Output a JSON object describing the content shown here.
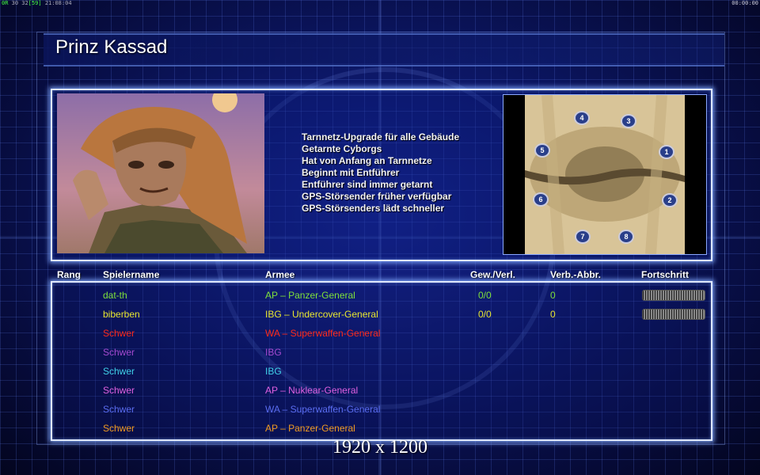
{
  "hud": {
    "left_prefix": "0R",
    "left_text": "30 32",
    "left_bracket": "[59]",
    "left_time": "21:08:04",
    "right_time": "00:00:00"
  },
  "title": "Prinz Kassad",
  "features": [
    "Tarnnetz-Upgrade für alle Gebäude",
    "Getarnte Cyborgs",
    "Hat von Anfang an Tarnnetze",
    "Beginnt mit Entführer",
    "Entführer sind immer getarnt",
    "GPS-Störsender früher verfügbar",
    "GPS-Störsenders lädt schneller"
  ],
  "map_slots": [
    "1",
    "2",
    "3",
    "4",
    "5",
    "6",
    "7",
    "8"
  ],
  "table_headers": {
    "rank": "Rang",
    "player": "Spielername",
    "army": "Armee",
    "winloss": "Gew./Verl.",
    "disconnects": "Verb.-Abbr.",
    "progress": "Fortschritt"
  },
  "players": [
    {
      "name": "dat-th",
      "army": "AP – Panzer-General",
      "winloss": "0/0",
      "disconnects": "0",
      "color": "#7ee03a",
      "progress": "bar"
    },
    {
      "name": "biberben",
      "army": "IBG – Undercover-General",
      "winloss": "0/0",
      "disconnects": "0",
      "color": "#e8e630",
      "progress": "bar"
    },
    {
      "name": "Schwer",
      "army": "WA – Superwaffen-General",
      "winloss": "",
      "disconnects": "",
      "color": "#ff2a1a",
      "progress": ""
    },
    {
      "name": "Schwer",
      "army": "IBG",
      "winloss": "",
      "disconnects": "",
      "color": "#a44ad0",
      "progress": ""
    },
    {
      "name": "Schwer",
      "army": "IBG",
      "winloss": "",
      "disconnects": "",
      "color": "#40d0e8",
      "progress": ""
    },
    {
      "name": "Schwer",
      "army": "AP – Nuklear-General",
      "winloss": "",
      "disconnects": "",
      "color": "#e060e0",
      "progress": ""
    },
    {
      "name": "Schwer",
      "army": "WA – Superwaffen-General",
      "winloss": "",
      "disconnects": "",
      "color": "#5a6cf0",
      "progress": ""
    },
    {
      "name": "Schwer",
      "army": "AP – Panzer-General",
      "winloss": "",
      "disconnects": "",
      "color": "#f09a20",
      "progress": ""
    }
  ],
  "resolution_label": "1920 x 1200",
  "colors": {
    "frame_glow": "#8aaaff",
    "background": "#0b1560"
  }
}
